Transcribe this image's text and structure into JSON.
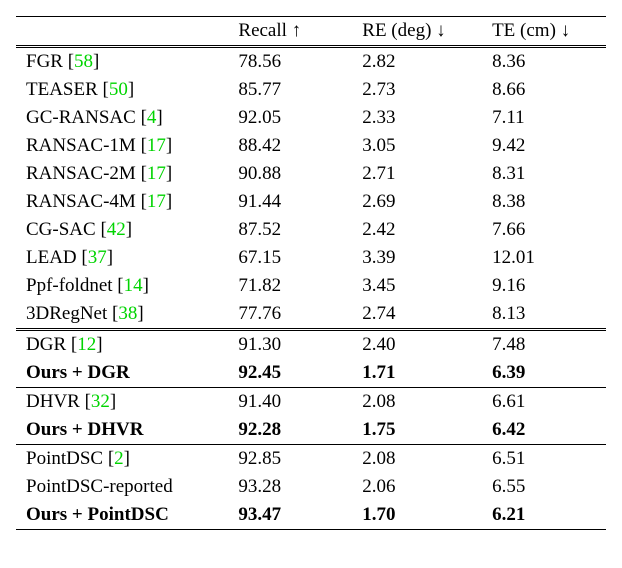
{
  "header": {
    "recall": "Recall ↑",
    "re": "RE (deg) ↓",
    "te": "TE (cm) ↓"
  },
  "sections": [
    {
      "rows": [
        {
          "name": "FGR",
          "cite": "58",
          "recall": "78.56",
          "re": "2.82",
          "te": "8.36",
          "bold": false
        },
        {
          "name": "TEASER",
          "cite": "50",
          "recall": "85.77",
          "re": "2.73",
          "te": "8.66",
          "bold": false
        },
        {
          "name": "GC-RANSAC",
          "cite": "4",
          "recall": "92.05",
          "re": "2.33",
          "te": "7.11",
          "bold": false
        },
        {
          "name": "RANSAC-1M",
          "cite": "17",
          "recall": "88.42",
          "re": "3.05",
          "te": "9.42",
          "bold": false
        },
        {
          "name": "RANSAC-2M",
          "cite": "17",
          "recall": "90.88",
          "re": "2.71",
          "te": "8.31",
          "bold": false
        },
        {
          "name": "RANSAC-4M",
          "cite": "17",
          "recall": "91.44",
          "re": "2.69",
          "te": "8.38",
          "bold": false
        },
        {
          "name": "CG-SAC",
          "cite": "42",
          "recall": "87.52",
          "re": "2.42",
          "te": "7.66",
          "bold": false
        },
        {
          "name": "LEAD",
          "cite": "37",
          "recall": "67.15",
          "re": "3.39",
          "te": "12.01",
          "bold": false
        },
        {
          "name": "Ppf-foldnet",
          "cite": "14",
          "recall": "71.82",
          "re": "3.45",
          "te": "9.16",
          "bold": false
        },
        {
          "name": "3DRegNet",
          "cite": "38",
          "recall": "77.76",
          "re": "2.74",
          "te": "8.13",
          "bold": false
        }
      ]
    },
    {
      "rows": [
        {
          "name": "DGR",
          "cite": "12",
          "recall": "91.30",
          "re": "2.40",
          "te": "7.48",
          "bold": false
        },
        {
          "name": "Ours + DGR",
          "cite": "",
          "recall": "92.45",
          "re": "1.71",
          "te": "6.39",
          "bold": true
        }
      ]
    },
    {
      "rows": [
        {
          "name": "DHVR",
          "cite": "32",
          "recall": "91.40",
          "re": "2.08",
          "te": "6.61",
          "bold": false
        },
        {
          "name": "Ours + DHVR",
          "cite": "",
          "recall": "92.28",
          "re": "1.75",
          "te": "6.42",
          "bold": true
        }
      ]
    },
    {
      "rows": [
        {
          "name": "PointDSC",
          "cite": "2",
          "recall": "92.85",
          "re": "2.08",
          "te": "6.51",
          "bold": false
        },
        {
          "name": "PointDSC-reported",
          "cite": "",
          "recall": "93.28",
          "re": "2.06",
          "te": "6.55",
          "bold": false
        },
        {
          "name": "Ours + PointDSC",
          "cite": "",
          "recall": "93.47",
          "re": "1.70",
          "te": "6.21",
          "bold": true
        }
      ]
    }
  ]
}
